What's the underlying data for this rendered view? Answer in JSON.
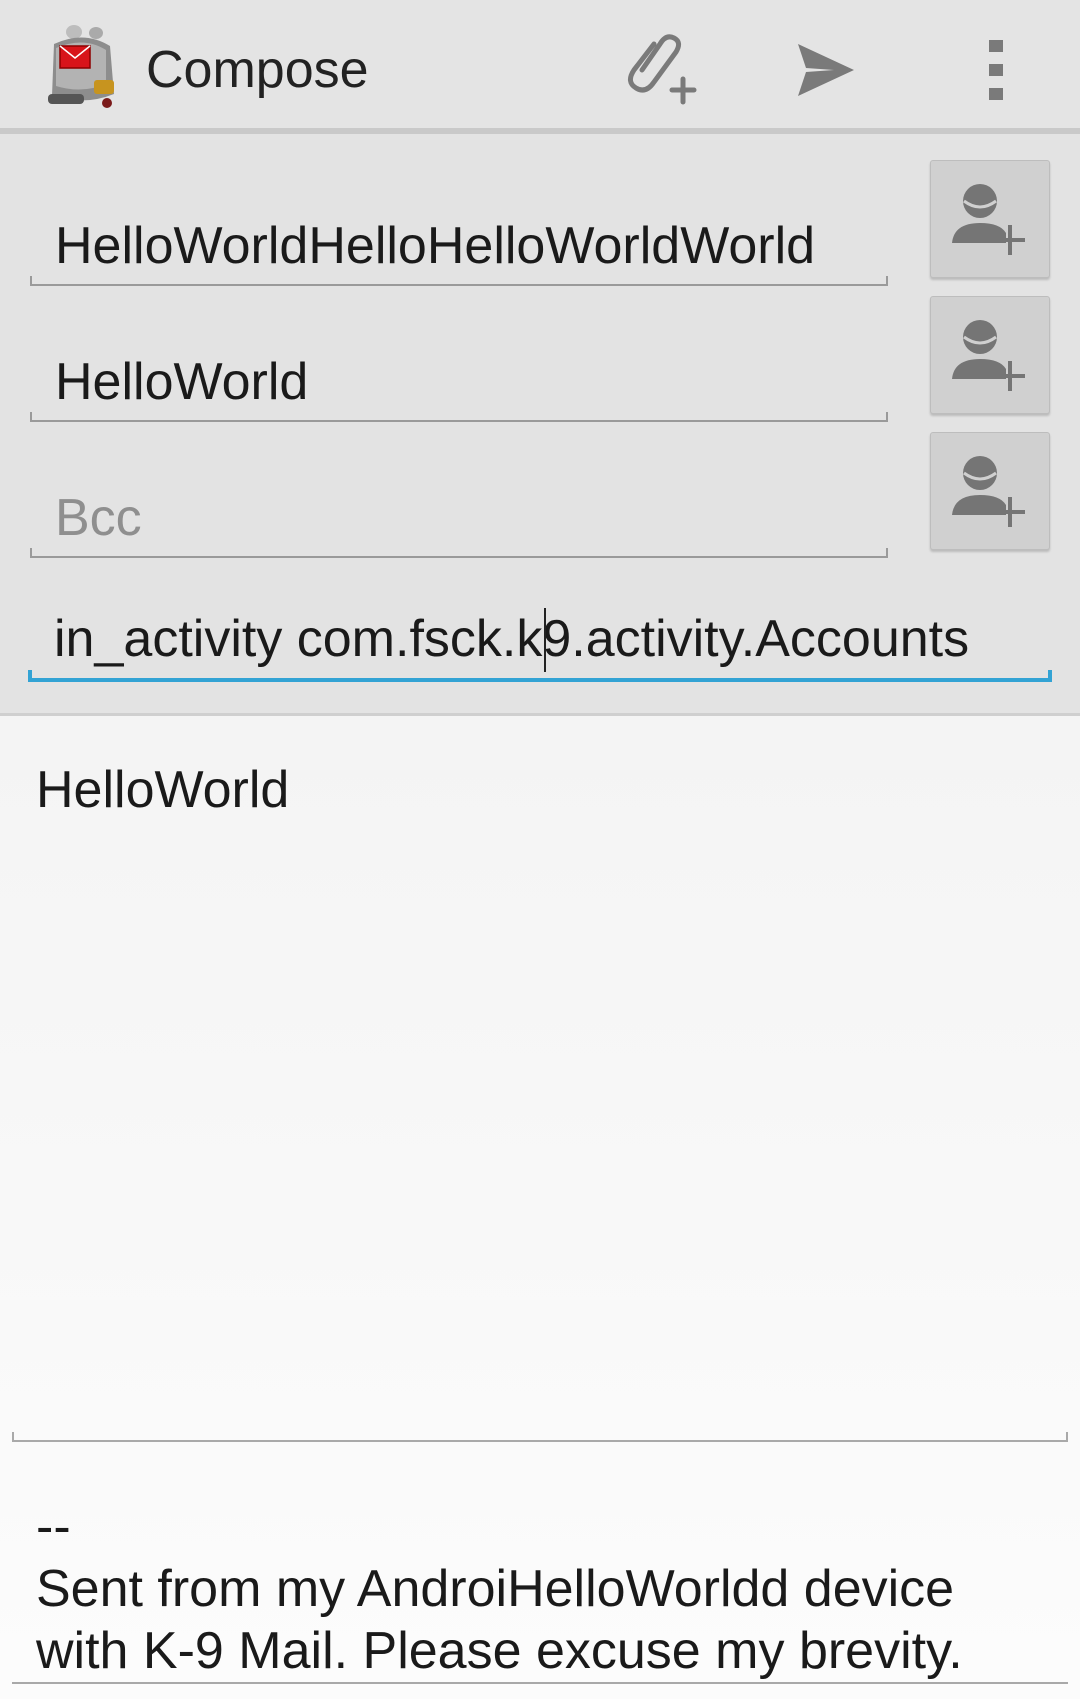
{
  "actionbar": {
    "title": "Compose",
    "icons": {
      "app": "k9-mail-dog-icon",
      "attach": "attach-icon",
      "send": "send-icon",
      "overflow": "overflow-menu-icon"
    }
  },
  "fields": {
    "to_value": "HelloWorldHelloHelloWorldWorld",
    "cc_value": "HelloWorld",
    "bcc_placeholder": "Bcc",
    "subject_value": "in_activity com.fsck.k9.activity.Accounts"
  },
  "message": {
    "body": "HelloWorld",
    "signature": "--\nSent from my AndroiHelloWorldd device with K-9 Mail. Please excuse my brevity."
  },
  "colors": {
    "focus_accent": "#33a3d4",
    "actionbar_bg": "#e4e4e4"
  }
}
